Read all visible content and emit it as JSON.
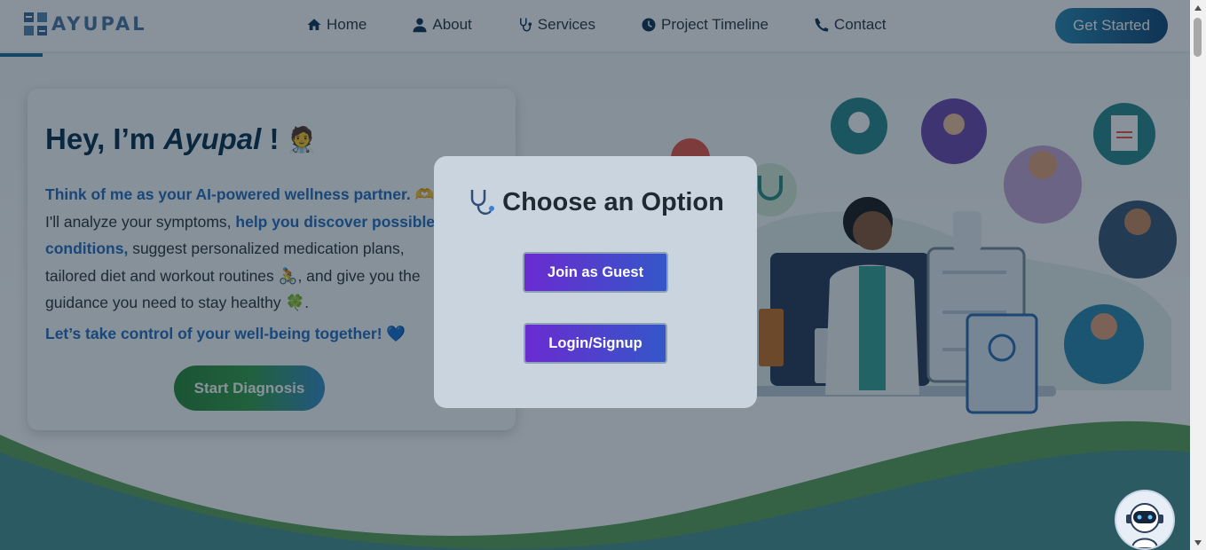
{
  "brand": {
    "name": "AYUPAL"
  },
  "nav": {
    "items": [
      {
        "label": "Home",
        "icon": "home-icon"
      },
      {
        "label": "About",
        "icon": "user-icon"
      },
      {
        "label": "Services",
        "icon": "stethoscope-icon"
      },
      {
        "label": "Project Timeline",
        "icon": "clock-icon"
      },
      {
        "label": "Contact",
        "icon": "phone-icon"
      }
    ],
    "cta_label": "Get Started"
  },
  "hero": {
    "title_prefix": "Hey, I’m ",
    "title_name": "Ayupal",
    "title_suffix": " !",
    "title_emoji": "🧑‍⚕️",
    "para": {
      "hl1": "Think of me as your AI-powered wellness partner.",
      "emoji1": "🫶",
      "t1": " I'll analyze your symptoms, ",
      "hl2": "help you discover possible conditions,",
      "t2": " suggest personalized medication plans, tailored diet and workout routines ",
      "emoji2": "🚴",
      "t3": ", and give you the guidance you need to stay healthy ",
      "emoji3": "🍀",
      "t4": "."
    },
    "cta_text": "Let’s take control of your well-being together!",
    "cta_emoji": "💙",
    "button_label": "Start Diagnosis"
  },
  "modal": {
    "title": "Choose an Option",
    "guest_label": "Join as Guest",
    "login_label": "Login/Signup"
  },
  "colors": {
    "primary": "#12365a",
    "accent_blue": "#2a6fc0",
    "modal_btn_from": "#6a2bd0",
    "modal_btn_to": "#3457c8",
    "overlay": "rgba(8,28,44,0.48)"
  }
}
